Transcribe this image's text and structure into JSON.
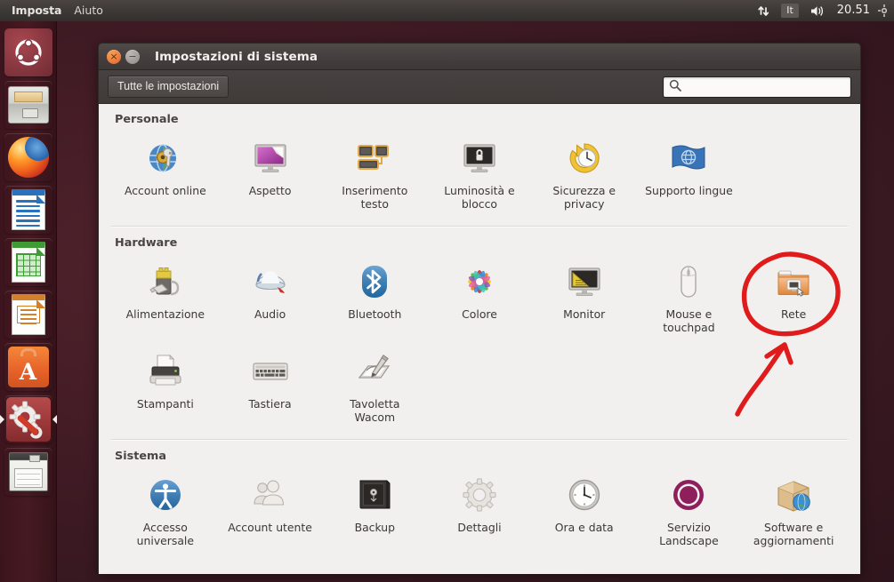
{
  "panel": {
    "menus": [
      {
        "label": "Imposta",
        "name": "panel-menu-impostazioni"
      },
      {
        "label": "Aiuto",
        "name": "panel-menu-aiuto"
      }
    ],
    "indicators": {
      "network_icon": "network-up-down-icon",
      "keyboard_layout": "It",
      "volume_icon": "volume-icon",
      "clock": "20.51",
      "gear_icon": "session-gear-icon"
    }
  },
  "launcher": {
    "items": [
      {
        "label": "Dash home",
        "icon": "ubuntu-dash-icon",
        "active": false
      },
      {
        "label": "File",
        "icon": "files-icon",
        "active": false
      },
      {
        "label": "Firefox",
        "icon": "firefox-icon",
        "active": false
      },
      {
        "label": "LibreOffice Writer",
        "icon": "libreoffice-writer-icon",
        "active": false
      },
      {
        "label": "LibreOffice Calc",
        "icon": "libreoffice-calc-icon",
        "active": false
      },
      {
        "label": "LibreOffice Impress",
        "icon": "libreoffice-impress-icon",
        "active": false
      },
      {
        "label": "Ubuntu Software",
        "icon": "ubuntu-software-icon",
        "active": false
      },
      {
        "label": "Impostazioni di sistema",
        "icon": "system-settings-icon",
        "active": true
      },
      {
        "label": "Dispositivo",
        "icon": "floppy-drive-icon",
        "active": false
      }
    ]
  },
  "window": {
    "title": "Impostazioni di sistema",
    "close_glyph": "×",
    "minimize_glyph": "−",
    "toolbar": {
      "all_settings_label": "Tutte le impostazioni",
      "search_placeholder": "",
      "search_value": "",
      "search_icon": "search-icon"
    },
    "sections": [
      {
        "title": "Personale",
        "items": [
          {
            "label": "Account online",
            "icon": "online-accounts-icon"
          },
          {
            "label": "Aspetto",
            "icon": "appearance-icon"
          },
          {
            "label": "Inserimento testo",
            "icon": "text-entry-icon"
          },
          {
            "label": "Luminosità e blocco",
            "icon": "brightness-lock-icon"
          },
          {
            "label": "Sicurezza e privacy",
            "icon": "security-privacy-icon"
          },
          {
            "label": "Supporto lingue",
            "icon": "language-support-icon"
          }
        ]
      },
      {
        "title": "Hardware",
        "items": [
          {
            "label": "Alimentazione",
            "icon": "power-icon"
          },
          {
            "label": "Audio",
            "icon": "sound-icon"
          },
          {
            "label": "Bluetooth",
            "icon": "bluetooth-icon"
          },
          {
            "label": "Colore",
            "icon": "color-icon"
          },
          {
            "label": "Monitor",
            "icon": "displays-icon"
          },
          {
            "label": "Mouse e touchpad",
            "icon": "mouse-touchpad-icon"
          },
          {
            "label": "Rete",
            "icon": "network-icon",
            "highlighted": true
          },
          {
            "label": "Stampanti",
            "icon": "printers-icon"
          },
          {
            "label": "Tastiera",
            "icon": "keyboard-icon"
          },
          {
            "label": "Tavoletta Wacom",
            "icon": "wacom-tablet-icon"
          }
        ]
      },
      {
        "title": "Sistema",
        "items": [
          {
            "label": "Accesso universale",
            "icon": "universal-access-icon"
          },
          {
            "label": "Account utente",
            "icon": "user-accounts-icon"
          },
          {
            "label": "Backup",
            "icon": "backup-icon"
          },
          {
            "label": "Dettagli",
            "icon": "details-icon"
          },
          {
            "label": "Ora e data",
            "icon": "time-date-icon"
          },
          {
            "label": "Servizio Landscape",
            "icon": "landscape-service-icon"
          },
          {
            "label": "Software e aggiornamenti",
            "icon": "software-updates-icon"
          }
        ]
      }
    ]
  },
  "annotations": {
    "circle": {
      "target": "Rete",
      "color": "#e01b1b"
    },
    "arrow": {
      "points_to": "Rete",
      "color": "#e01b1b"
    }
  },
  "colors": {
    "desktop": "#45202a",
    "panel": "#3d3937",
    "window_chrome": "#464140",
    "content_bg": "#f1f0ee",
    "accent_orange": "#e8733a",
    "annotation_red": "#e01b1b"
  }
}
